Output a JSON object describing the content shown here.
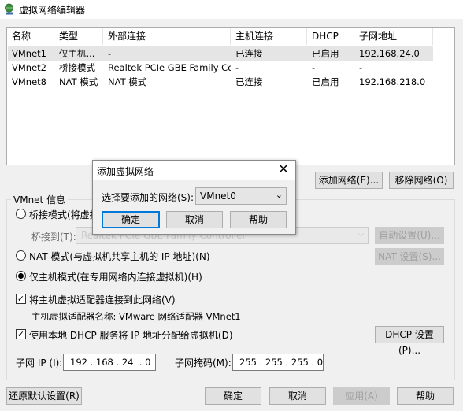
{
  "window": {
    "title": "虚拟网络编辑器",
    "icon": "network-globe-icon"
  },
  "table": {
    "columns": [
      "名称",
      "类型",
      "外部连接",
      "主机连接",
      "DHCP",
      "子网地址"
    ],
    "rows": [
      [
        "VMnet1",
        "仅主机...",
        "-",
        "已连接",
        "已启用",
        "192.168.24.0"
      ],
      [
        "VMnet2",
        "桥接模式",
        "Realtek PCIe GBE Family Co...",
        "-",
        "-",
        "-"
      ],
      [
        "VMnet8",
        "NAT 模式",
        "NAT 模式",
        "已连接",
        "已启用",
        "192.168.218.0"
      ]
    ]
  },
  "buttons": {
    "add_network": "添加网络(E)...",
    "remove_network": "移除网络(O)",
    "auto_settings": "自动设置(U)...",
    "nat_settings": "NAT 设置(S)...",
    "dhcp_settings": "DHCP 设置(P)...",
    "restore_defaults": "还原默认设置(R)",
    "ok": "确定",
    "cancel": "取消",
    "apply": "应用(A)",
    "help": "帮助"
  },
  "vmnet_info": {
    "legend": "VMnet 信息",
    "bridged_label": "桥接模式(将虚拟",
    "bridged_to_label": "桥接到(T):",
    "bridged_to_value": "Realtek PCIe GBE Family Controller",
    "nat_label": "NAT 模式(与虚拟机共享主机的 IP 地址)(N)",
    "hostonly_label": "仅主机模式(在专用网络内连接虚拟机)(H)",
    "connect_adapter_label": "将主机虚拟适配器连接到此网络(V)",
    "adapter_name_label": "主机虚拟适配器名称: VMware 网络适配器 VMnet1",
    "use_dhcp_label": "使用本地 DHCP 服务将 IP 地址分配给虚拟机(D)",
    "subnet_ip_label": "子网 IP (I):",
    "subnet_ip_value": "192 . 168 . 24  . 0",
    "subnet_mask_label": "子网掩码(M):",
    "subnet_mask_value": "255 . 255 . 255 . 0",
    "selected_mode": "hostonly",
    "connect_adapter_checked": true,
    "use_dhcp_checked": true
  },
  "dialog": {
    "title": "添加虚拟网络",
    "prompt": "选择要添加的网络(S):",
    "selected": "VMnet0",
    "ok": "确定",
    "cancel": "取消",
    "help": "帮助",
    "close_icon": "close-icon"
  },
  "colors": {
    "accent": "#0078d7",
    "selection": "#e5e5e5"
  }
}
